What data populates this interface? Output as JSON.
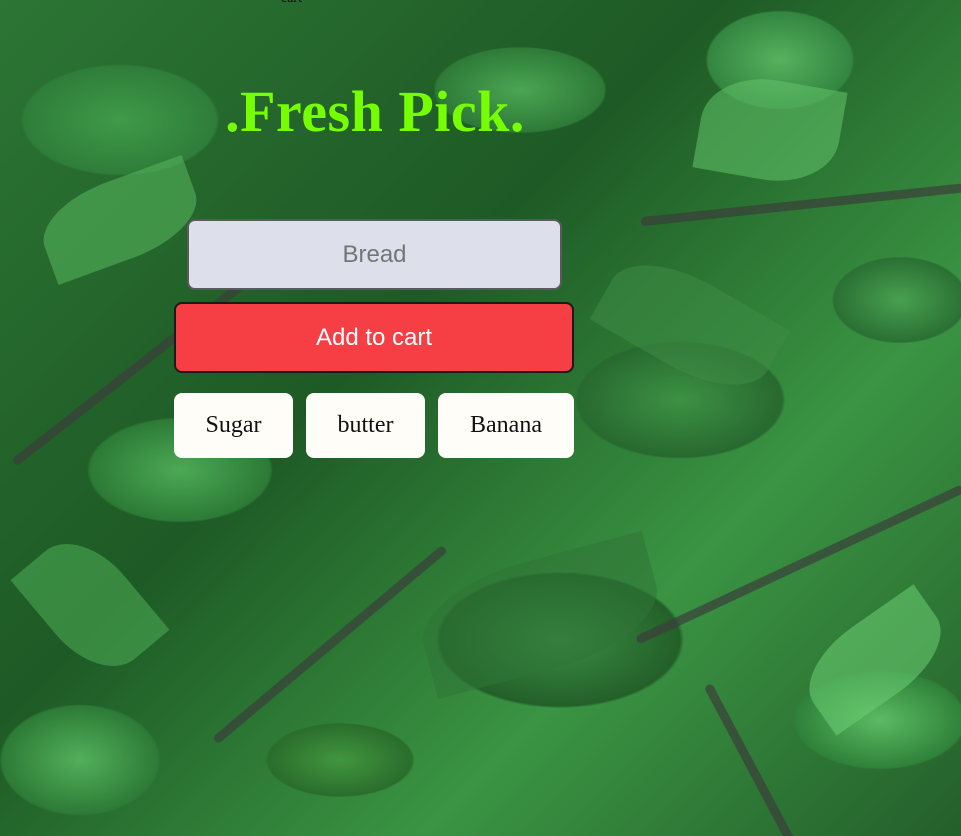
{
  "nav": {
    "label": "cart"
  },
  "header": {
    "title": ".Fresh Pick."
  },
  "form": {
    "input_placeholder": "Bread",
    "add_button_label": "Add to cart"
  },
  "items": [
    {
      "label": "Sugar"
    },
    {
      "label": "butter"
    },
    {
      "label": "Banana"
    }
  ],
  "colors": {
    "title": "#76ff03",
    "add_button": "#f63f45",
    "input_background": "#dde0eb",
    "chip_background": "#fffdf8"
  }
}
